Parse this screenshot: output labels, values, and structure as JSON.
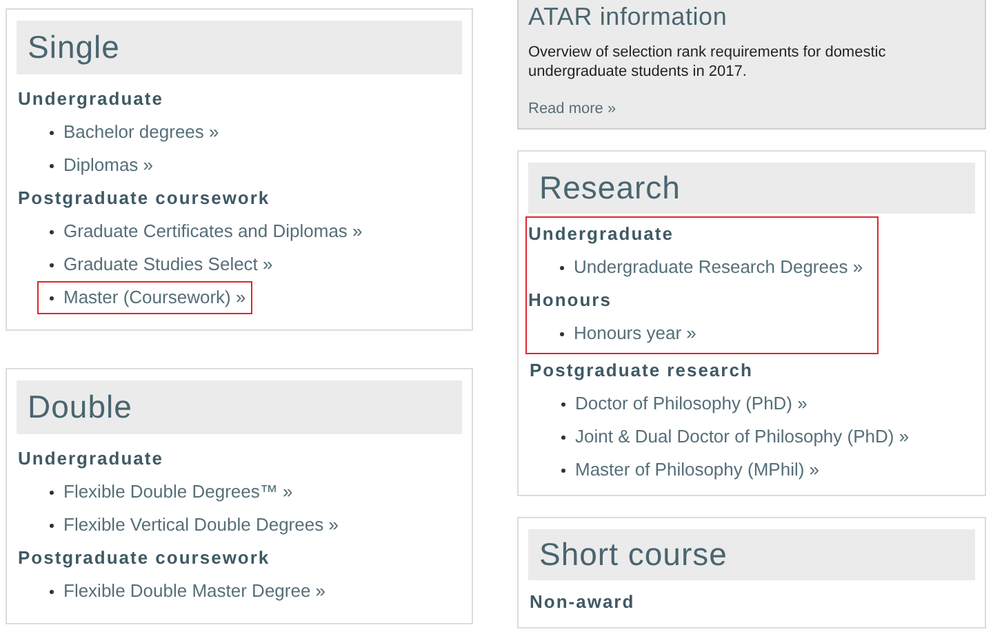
{
  "left_column": [
    {
      "title": "Single",
      "groups": [
        {
          "heading": "Undergraduate",
          "highlighted": false,
          "links": [
            {
              "label": "Bachelor degrees »",
              "highlighted": false
            },
            {
              "label": "Diplomas »",
              "highlighted": false
            }
          ]
        },
        {
          "heading": "Postgraduate coursework",
          "highlighted": false,
          "links": [
            {
              "label": "Graduate Certificates and Diplomas »",
              "highlighted": false
            },
            {
              "label": "Graduate Studies Select »",
              "highlighted": false
            },
            {
              "label": "Master (Coursework) »",
              "highlighted": true
            }
          ]
        }
      ]
    },
    {
      "title": "Double",
      "groups": [
        {
          "heading": "Undergraduate",
          "highlighted": false,
          "links": [
            {
              "label": "Flexible Double Degrees™ »",
              "highlighted": false
            },
            {
              "label": "Flexible Vertical Double Degrees »",
              "highlighted": false
            }
          ]
        },
        {
          "heading": "Postgraduate coursework",
          "highlighted": false,
          "links": [
            {
              "label": "Flexible Double Master Degree »",
              "highlighted": false
            }
          ]
        }
      ]
    }
  ],
  "atar_card": {
    "title": "ATAR information",
    "text": "Overview of selection rank requirements for domestic undergraduate students in 2017.",
    "link": "Read more »"
  },
  "right_column": [
    {
      "title": "Research",
      "groups": [
        {
          "heading": "Undergraduate",
          "highlighted": true,
          "links": [
            {
              "label": "Undergraduate Research Degrees »",
              "highlighted": false
            }
          ]
        },
        {
          "heading": "Honours",
          "highlighted": true,
          "links": [
            {
              "label": "Honours year »",
              "highlighted": false
            }
          ]
        },
        {
          "heading": "Postgraduate research",
          "highlighted": false,
          "links": [
            {
              "label": "Doctor of Philosophy (PhD) »",
              "highlighted": false
            },
            {
              "label": "Joint & Dual Doctor of Philosophy (PhD) »",
              "highlighted": false
            },
            {
              "label": "Master of Philosophy (MPhil) »",
              "highlighted": false
            }
          ]
        }
      ]
    },
    {
      "title": "Short course",
      "groups": [
        {
          "heading": "Non-award",
          "highlighted": false
        }
      ]
    }
  ]
}
